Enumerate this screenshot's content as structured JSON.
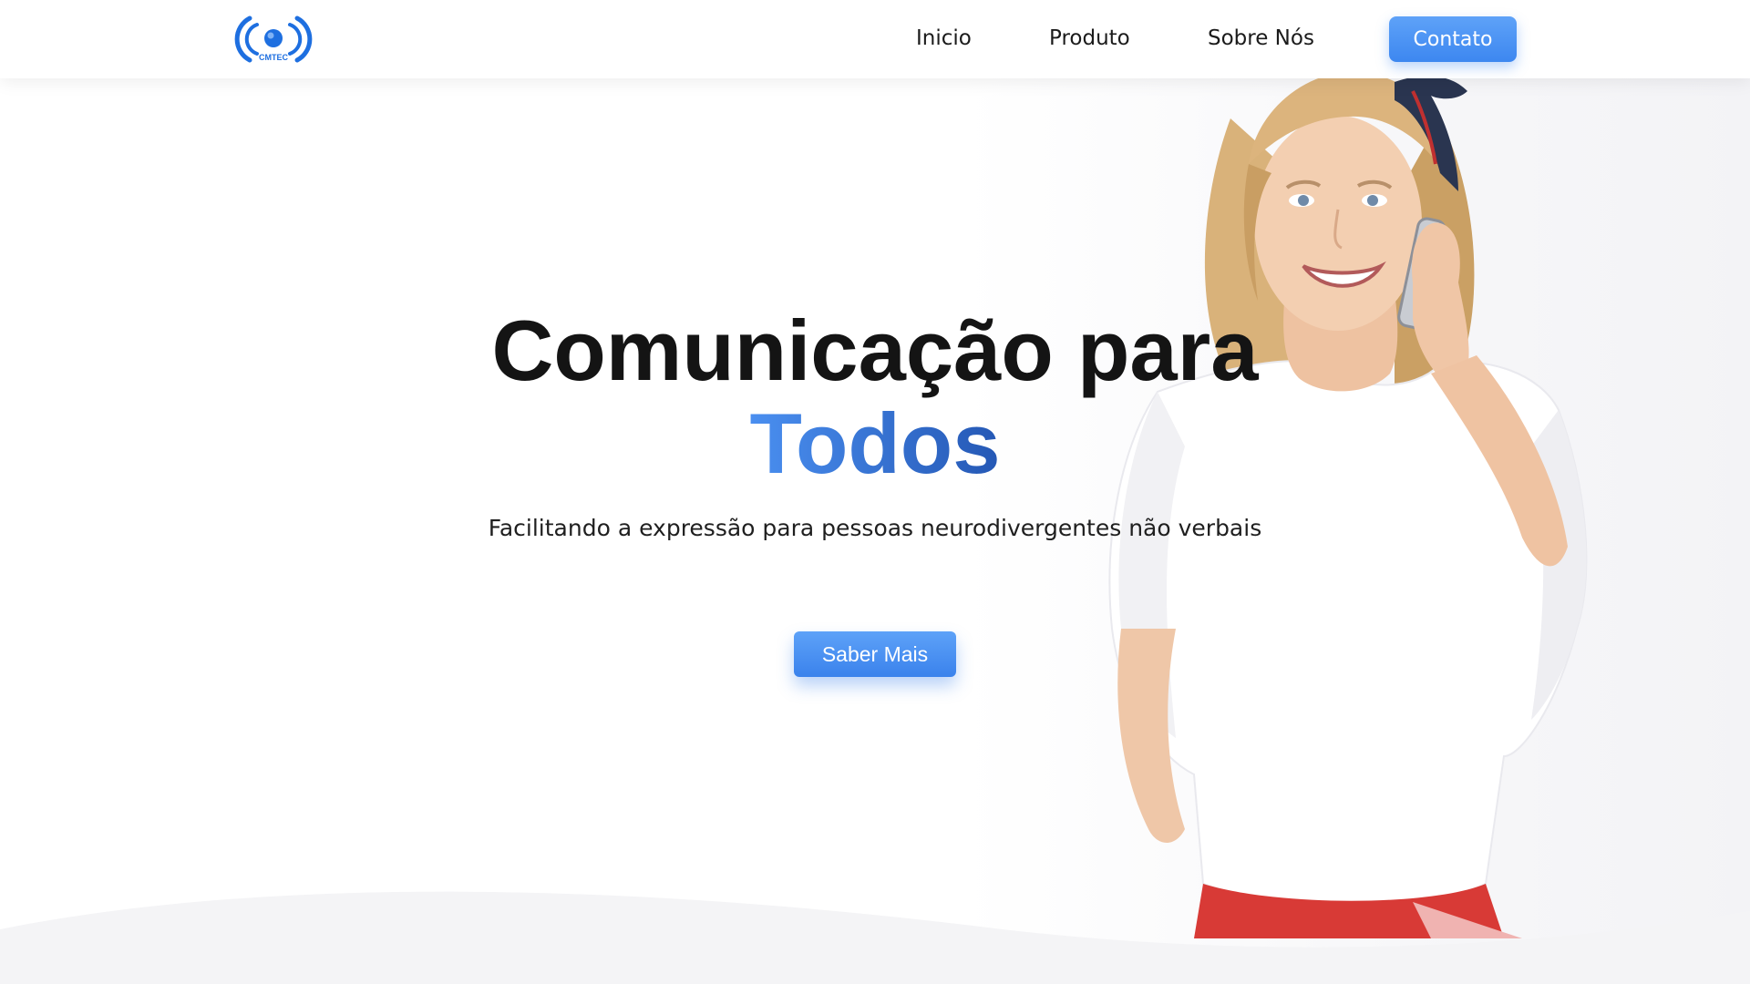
{
  "brand": {
    "logo_text": "CMTEC",
    "accent_color": "#3d87f0",
    "logo_color": "#1e6fe0"
  },
  "nav": {
    "items": [
      {
        "label": "Inicio"
      },
      {
        "label": "Produto"
      },
      {
        "label": "Sobre Nós"
      }
    ],
    "contact_label": "Contato"
  },
  "hero": {
    "title_line1": "Comunicação para",
    "title_line2": "Todos",
    "subtitle": "Facilitando a expressão para pessoas neurodivergentes não verbais",
    "cta_label": "Saber Mais",
    "image": "woman-on-phone-illustration"
  }
}
